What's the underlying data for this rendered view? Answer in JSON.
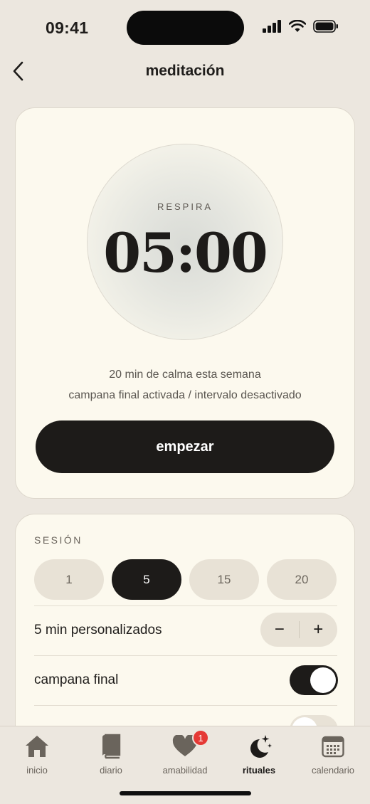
{
  "status": {
    "time": "09:41"
  },
  "header": {
    "title": "meditación",
    "back_icon": "chevron-left-icon"
  },
  "timer": {
    "label": "RESPIRA",
    "time": "05:00",
    "stats_line1": "20 min de calma esta semana",
    "stats_line2": "campana final activada / intervalo desactivado",
    "start_label": "empezar"
  },
  "session": {
    "section_label": "SESIÓN",
    "durations": [
      "1",
      "5",
      "15",
      "20"
    ],
    "selected_duration": "5",
    "custom_label": "5 min personalizados",
    "decrement": "−",
    "increment": "+",
    "final_bell_label": "campana final",
    "final_bell_on": true,
    "interval_bell_on": false
  },
  "tabs": [
    {
      "label": "inicio",
      "icon": "home-icon"
    },
    {
      "label": "diario",
      "icon": "book-icon"
    },
    {
      "label": "amabilidad",
      "icon": "heart-icon",
      "badge": "1"
    },
    {
      "label": "rituales",
      "icon": "moon-stars-icon",
      "active": true
    },
    {
      "label": "calendario",
      "icon": "calendar-icon"
    }
  ],
  "colors": {
    "background": "#ece7df",
    "card": "#fcf9ee",
    "primary": "#1d1b19",
    "chip": "#e8e2d6",
    "badge": "#e53935"
  }
}
